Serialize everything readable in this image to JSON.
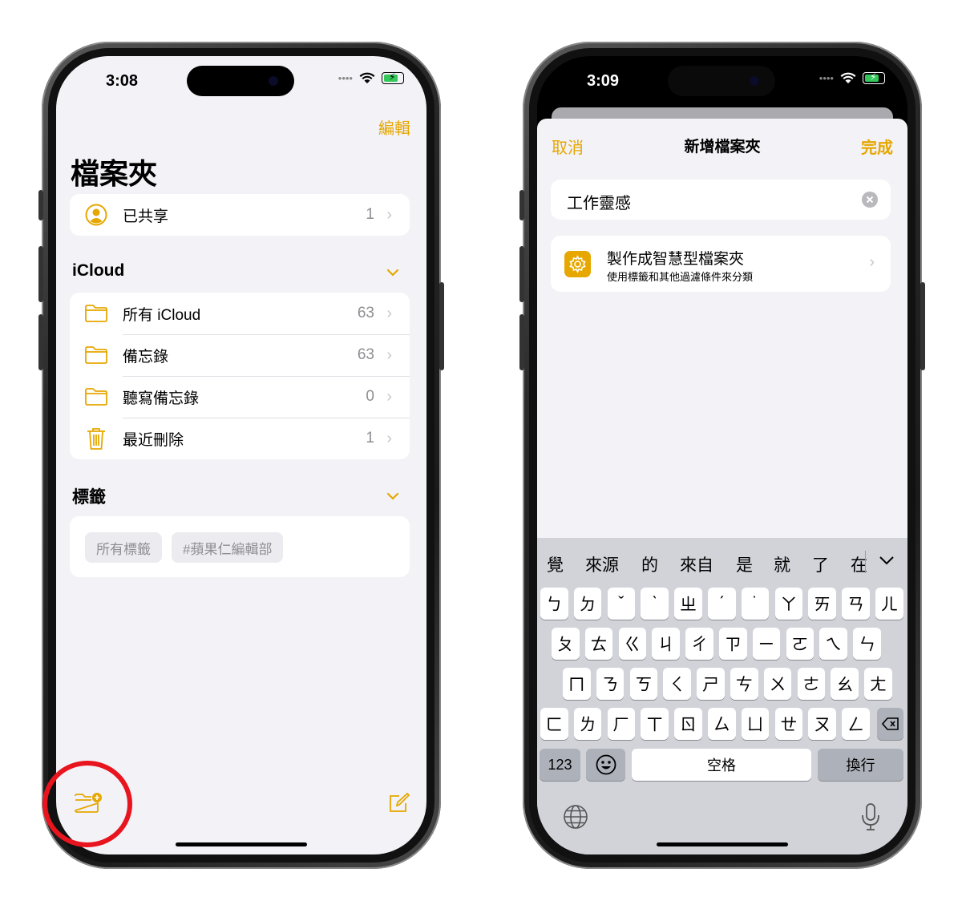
{
  "left": {
    "time": "3:08",
    "edit": "編輯",
    "title": "檔案夾",
    "shared": {
      "label": "已共享",
      "count": "1"
    },
    "icloud_header": "iCloud",
    "folders": [
      {
        "label": "所有 iCloud",
        "count": "63",
        "icon": "folder-icon"
      },
      {
        "label": "備忘錄",
        "count": "63",
        "icon": "folder-icon"
      },
      {
        "label": "聽寫備忘錄",
        "count": "0",
        "icon": "folder-icon"
      },
      {
        "label": "最近刪除",
        "count": "1",
        "icon": "trash-icon"
      }
    ],
    "tags_header": "標籤",
    "tags": [
      "所有標籤",
      "#蘋果仁編輯部"
    ],
    "colors": {
      "accent": "#e6a700",
      "highlight_circle": "#e8141e"
    }
  },
  "right": {
    "time": "3:09",
    "cancel": "取消",
    "sheet_title": "新增檔案夾",
    "done": "完成",
    "name_value": "工作靈感",
    "smart_title": "製作成智慧型檔案夾",
    "smart_subtitle": "使用標籤和其他過濾條件來分類",
    "candidates": [
      "覺",
      "來源",
      "的",
      "來自",
      "是",
      "就",
      "了",
      "在"
    ],
    "row1": [
      "ㄅ",
      "ㄉ",
      "ˇ",
      "ˋ",
      "ㄓ",
      "ˊ",
      "˙",
      "ㄚ",
      "ㄞ",
      "ㄢ",
      "ㄦ"
    ],
    "row2": [
      "ㄆ",
      "ㄊ",
      "ㄍ",
      "ㄐ",
      "ㄔ",
      "ㄗ",
      "ㄧ",
      "ㄛ",
      "ㄟ",
      "ㄣ"
    ],
    "row3": [
      "ㄇ",
      "ㄋ",
      "ㄎ",
      "ㄑ",
      "ㄕ",
      "ㄘ",
      "ㄨ",
      "ㄜ",
      "ㄠ",
      "ㄤ"
    ],
    "row4": [
      "ㄈ",
      "ㄌ",
      "ㄏ",
      "ㄒ",
      "ㄖ",
      "ㄙ",
      "ㄩ",
      "ㄝ",
      "ㄡ",
      "ㄥ"
    ],
    "numbers_key": "123",
    "space_key": "空格",
    "return_key": "換行"
  }
}
